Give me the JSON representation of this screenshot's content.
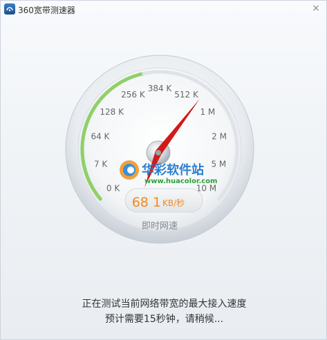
{
  "window": {
    "title": "360宽带测速器",
    "close_glyph": "×",
    "icon": "app-logo-icon"
  },
  "gauge": {
    "scale_labels": [
      "0 K",
      "7 K",
      "64 K",
      "128 K",
      "256 K",
      "384 K",
      "512 K",
      "1 M",
      "2 M",
      "5 M",
      "10 M"
    ],
    "current_speed_value": "68 1",
    "current_speed_unit": "KB/秒",
    "caption": "即时网速",
    "needle_color": "#d11a1a",
    "progress_color": "#8fd068",
    "speed_color": "#f08a1e"
  },
  "watermark": {
    "text": "华彩软件站",
    "url": "www.huacolor.com"
  },
  "status": {
    "line1": "正在测试当前网络带宽的最大接入速度",
    "line2": "预计需要15秒钟，请稍候..."
  }
}
